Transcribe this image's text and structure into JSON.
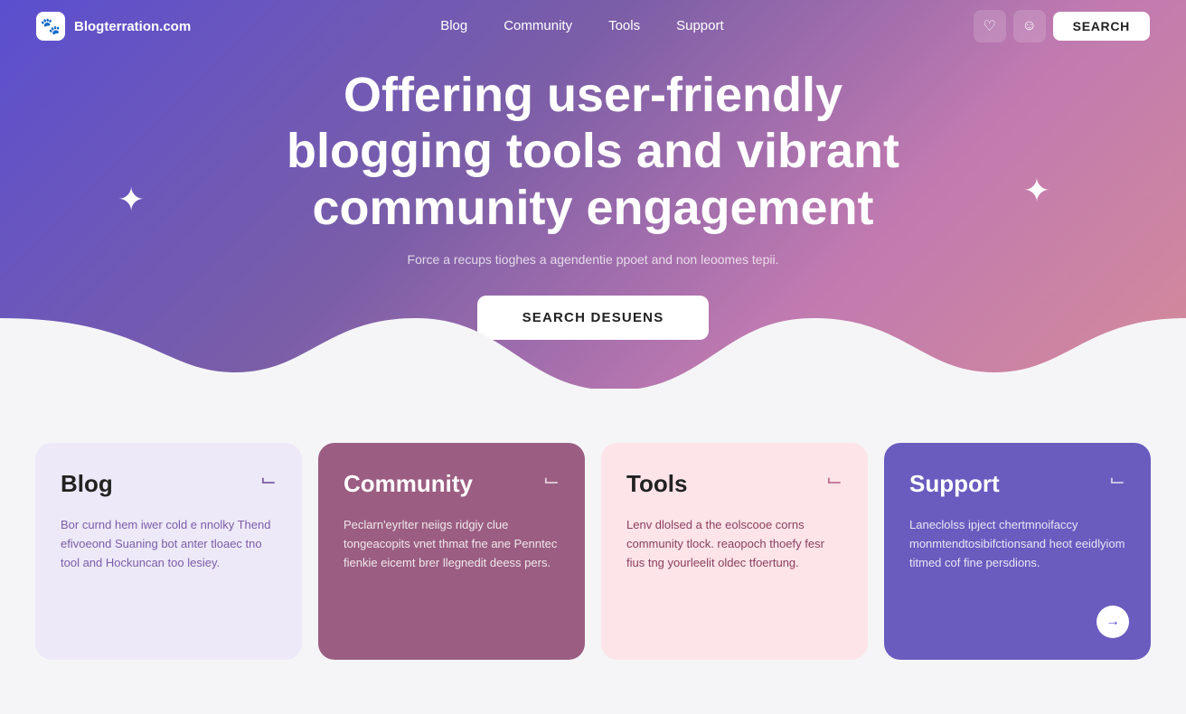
{
  "nav": {
    "logo_text": "Blogterration.com",
    "links": [
      {
        "id": "blog",
        "label": "Blog"
      },
      {
        "id": "community",
        "label": "Community"
      },
      {
        "id": "tools",
        "label": "Tools"
      },
      {
        "id": "support",
        "label": "Support"
      }
    ],
    "search_label": "SEARCH",
    "icon1": "♡",
    "icon2": "☺"
  },
  "hero": {
    "title": "Offering user-friendly blogging tools and vibrant community engagement",
    "subtitle": "Force a recups tioghes a agendentie ppoet and non leoomes tepii.",
    "cta_label": "SEARCH DESUENS"
  },
  "cards": [
    {
      "id": "blog",
      "title": "Blog",
      "icon": "⌙",
      "body": "Bor curnd hem iwer cold e nnolky Thend efivoeond Suaning bot anter tloaec tno tool and Hockuncan too lesiey.",
      "bg_class": "card-blog",
      "has_arrow": false
    },
    {
      "id": "community",
      "title": "Community",
      "icon": "⌙",
      "body": "Peclarn'eyrlter neiigs ridgiy clue tongeacopits vnet thmat fne ane Penntec fienkie eicemt brer llegnedit deess pers.",
      "bg_class": "card-community",
      "has_arrow": false
    },
    {
      "id": "tools",
      "title": "Tools",
      "icon": "⌙",
      "body": "Lenv dlolsed a the eolscooe corns community tlock. reaopoch thoefy fesr fius tng yourleelit oldec tfoertung.",
      "bg_class": "card-tools",
      "has_arrow": false
    },
    {
      "id": "support",
      "title": "Support",
      "icon": "⌙",
      "body": "Laneclolss ipject chertmnoifaccy monmtendtosibifctionsand heot eeidlyiom titmed cof fine persdions.",
      "bg_class": "card-support",
      "has_arrow": true
    }
  ]
}
